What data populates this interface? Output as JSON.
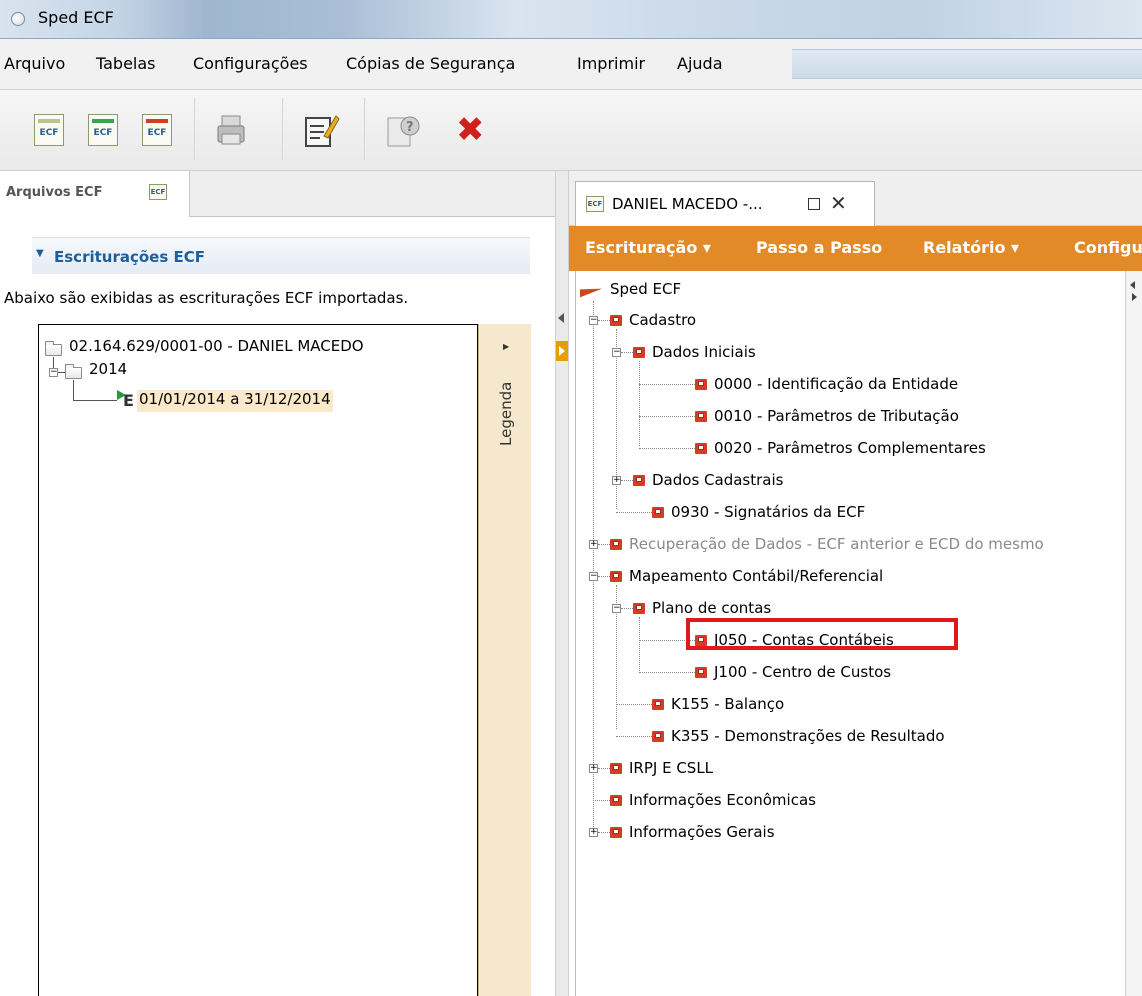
{
  "window": {
    "title": "Sped ECF"
  },
  "menu": [
    "Arquivo",
    "Tabelas",
    "Configurações",
    "Cópias de Segurança",
    "Imprimir",
    "Ajuda"
  ],
  "toolbar": {
    "buttons": [
      "ecf-doc-icon",
      "ecf-import-icon",
      "ecf-delete-icon",
      "printer-icon",
      "edit-icon",
      "help-icon",
      "close-icon"
    ],
    "ecf_label": "ECF"
  },
  "left_panel": {
    "tab_label": "Arquivos ECF",
    "section_title": "Escriturações ECF",
    "description": "Abaixo são exibidas as escriturações ECF importadas.",
    "legend_label": "Legenda",
    "tree": {
      "company": "02.164.629/0001-00 - DANIEL MACEDO",
      "year": "2014",
      "period": "01/01/2014 a 31/12/2014"
    }
  },
  "right_panel": {
    "tab_label": "DANIEL MACEDO -...",
    "actions": [
      "Escrituração ▾",
      "Passo a Passo",
      "Relatório ▾",
      "Configu"
    ],
    "tree": {
      "root": "Sped ECF",
      "cadastro": "Cadastro",
      "dados_iniciais": "Dados Iniciais",
      "r0000": "0000 - Identificação da Entidade",
      "r0010": "0010 - Parâmetros de Tributação",
      "r0020": "0020 - Parâmetros Complementares",
      "dados_cadastrais": "Dados Cadastrais",
      "r0930": "0930 - Signatários da ECF",
      "recuperacao": "Recuperação de Dados - ECF anterior e ECD do mesmo",
      "mapeamento": "Mapeamento Contábil/Referencial",
      "plano": "Plano de contas",
      "j050": "J050 - Contas Contábeis",
      "j100": "J100 - Centro de Custos",
      "k155": "K155 - Balanço",
      "k355": "K355 - Demonstrações de Resultado",
      "irpj": "IRPJ E CSLL",
      "info_econ": "Informações Econômicas",
      "info_gerais": "Informações Gerais"
    }
  },
  "colors": {
    "accent": "#e28a28",
    "highlight": "#e01a1a",
    "section_title": "#1b5f9e",
    "selected_bg": "#fbe9c9"
  }
}
